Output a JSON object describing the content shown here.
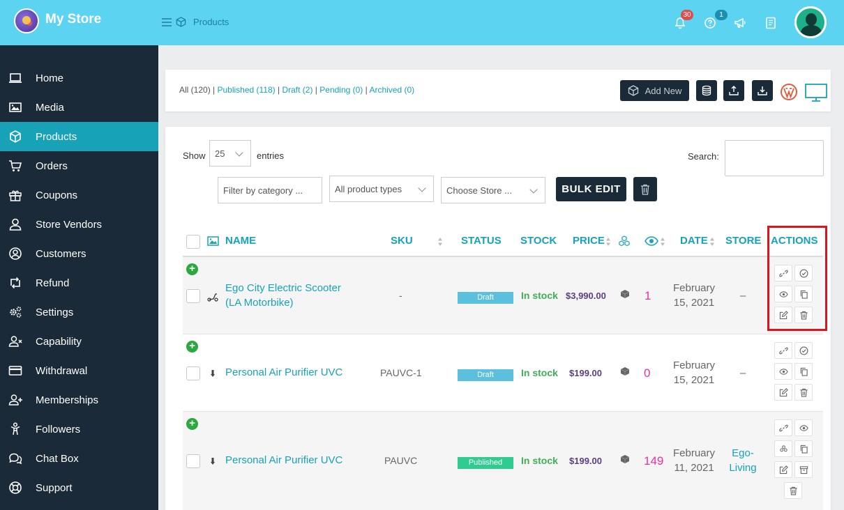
{
  "header": {
    "store_name": "My Store",
    "breadcrumb": "Products",
    "notifications_count": "30",
    "help_count": "1"
  },
  "sidebar": {
    "items": [
      {
        "label": "Home",
        "icon": "laptop-icon"
      },
      {
        "label": "Media",
        "icon": "image-icon"
      },
      {
        "label": "Products",
        "icon": "cube-icon",
        "active": true
      },
      {
        "label": "Orders",
        "icon": "cart-icon"
      },
      {
        "label": "Coupons",
        "icon": "gift-icon"
      },
      {
        "label": "Store Vendors",
        "icon": "user-icon"
      },
      {
        "label": "Customers",
        "icon": "user-circle-icon"
      },
      {
        "label": "Refund",
        "icon": "retweet-icon"
      },
      {
        "label": "Settings",
        "icon": "cogs-icon"
      },
      {
        "label": "Capability",
        "icon": "user-times-icon"
      },
      {
        "label": "Withdrawal",
        "icon": "credit-card-icon"
      },
      {
        "label": "Memberships",
        "icon": "user-plus-icon"
      },
      {
        "label": "Followers",
        "icon": "child-icon"
      },
      {
        "label": "Chat Box",
        "icon": "comments-icon"
      },
      {
        "label": "Support",
        "icon": "life-ring-icon"
      }
    ]
  },
  "status_filters": {
    "all": "All (120)",
    "published": "Published (118)",
    "draft": "Draft (2)",
    "pending": "Pending (0)",
    "archived": "Archived (0)",
    "sep": " | "
  },
  "toolbar": {
    "add_new": "Add New"
  },
  "controls": {
    "show_label": "Show",
    "entries_value": "25",
    "entries_label": "entries",
    "search_label": "Search:",
    "filter_category": "Filter by category ...",
    "product_types": "All product types",
    "choose_store": "Choose Store ...",
    "bulk_edit": "BULK EDIT"
  },
  "table": {
    "headers": {
      "name": "NAME",
      "sku": "SKU",
      "status": "STATUS",
      "stock": "STOCK",
      "price": "PRICE",
      "date": "DATE",
      "store": "STORE",
      "actions": "ACTIONS"
    },
    "rows": [
      {
        "name_line1": "Ego City Electric Scooter",
        "name_line2": "(LA Motorbike)",
        "sku": "-",
        "status": "Draft",
        "stock": "In stock",
        "price": "$3,990.00",
        "views": "1",
        "date_line1": "February",
        "date_line2": "15, 2021",
        "store_line1": "–",
        "store_line2": ""
      },
      {
        "name_line1": "Personal Air Purifier UVC",
        "name_line2": "",
        "sku": "PAUVC-1",
        "status": "Draft",
        "stock": "In stock",
        "price": "$199.00",
        "views": "0",
        "date_line1": "February",
        "date_line2": "15, 2021",
        "store_line1": "–",
        "store_line2": ""
      },
      {
        "name_line1": "Personal Air Purifier UVC",
        "name_line2": "",
        "sku": "PAUVC",
        "status": "Published",
        "stock": "In stock",
        "price": "$199.00",
        "views": "149",
        "date_line1": "February",
        "date_line2": "11, 2021",
        "store_line1": "Ego-",
        "store_line2": "Living"
      }
    ]
  },
  "colors": {
    "header_bg": "#5bd3f1",
    "sidebar_bg": "#1b2a38",
    "accent": "#17a2b8",
    "draft": "#5bc0de",
    "published": "#2ecc8f",
    "in_stock": "#3fae58",
    "views": "#e4349c",
    "highlight": "#d9161c"
  }
}
